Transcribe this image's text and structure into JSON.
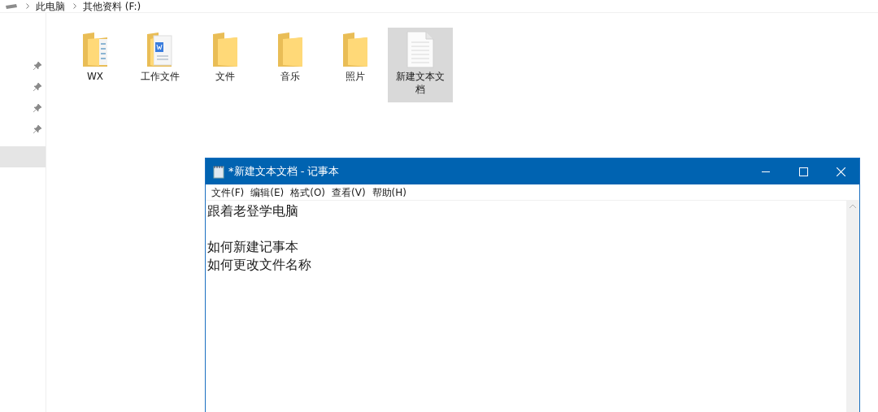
{
  "breadcrumb": [
    "此电脑",
    "其他资料 (F:)"
  ],
  "files": [
    {
      "name": "WX",
      "kind": "folder-docs",
      "selected": false
    },
    {
      "name": "工作文件",
      "kind": "folder-word",
      "selected": false
    },
    {
      "name": "文件",
      "kind": "folder",
      "selected": false
    },
    {
      "name": "音乐",
      "kind": "folder",
      "selected": false
    },
    {
      "name": "照片",
      "kind": "folder",
      "selected": false
    },
    {
      "name": "新建文本文档",
      "kind": "text-file",
      "selected": true
    }
  ],
  "notepad": {
    "title": "*新建文本文档 - 记事本",
    "menu": [
      "文件(F)",
      "编辑(E)",
      "格式(O)",
      "查看(V)",
      "帮助(H)"
    ],
    "paragraphs": [
      [
        "跟着老登学电脑"
      ],
      [
        "如何新建记事本",
        "如何更改文件名称"
      ]
    ]
  }
}
